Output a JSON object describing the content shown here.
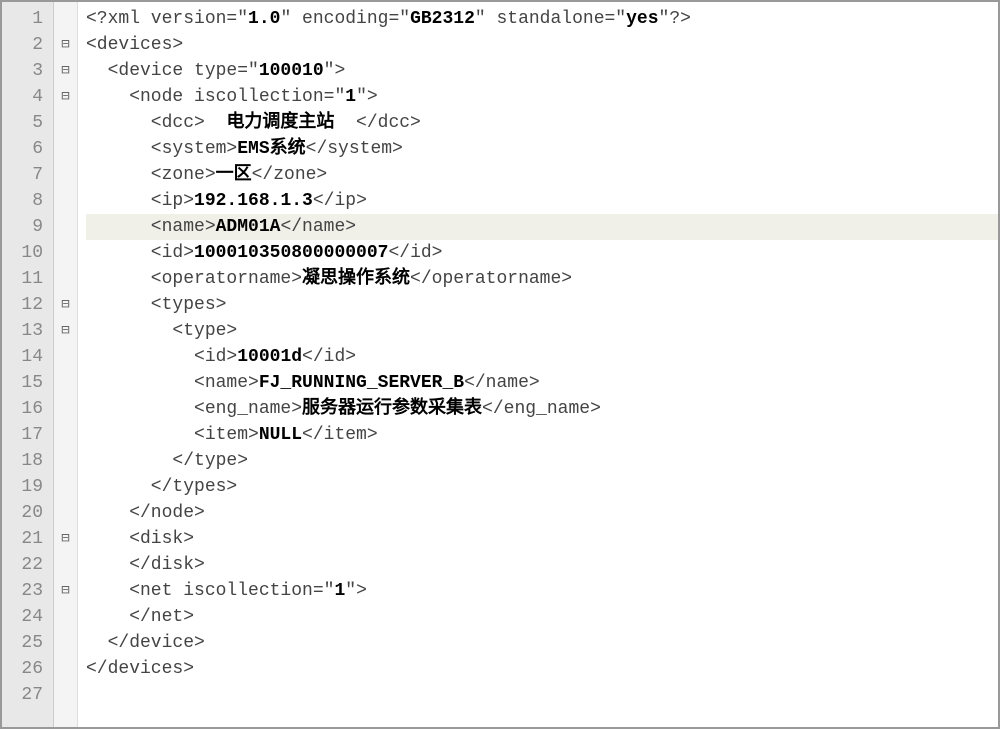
{
  "lines": {
    "1": {
      "ln": "1",
      "fold": "",
      "segs": [
        {
          "t": "<?xml version=\""
        },
        {
          "t": "1.0",
          "b": true
        },
        {
          "t": "\" encoding=\""
        },
        {
          "t": "GB2312",
          "b": true
        },
        {
          "t": "\" standalone=\""
        },
        {
          "t": "yes",
          "b": true
        },
        {
          "t": "\"?>"
        }
      ]
    },
    "2": {
      "ln": "2",
      "fold": "⊟",
      "segs": [
        {
          "t": "<devices>"
        }
      ]
    },
    "3": {
      "ln": "3",
      "fold": "⊟",
      "segs": [
        {
          "t": "  <device type=\""
        },
        {
          "t": "100010",
          "b": true
        },
        {
          "t": "\">"
        }
      ]
    },
    "4": {
      "ln": "4",
      "fold": "⊟",
      "segs": [
        {
          "t": "    <node iscollection=\""
        },
        {
          "t": "1",
          "b": true
        },
        {
          "t": "\">"
        }
      ]
    },
    "5": {
      "ln": "5",
      "fold": "",
      "segs": [
        {
          "t": "      <dcc>  "
        },
        {
          "t": "电力调度主站",
          "b": true
        },
        {
          "t": "  </dcc>"
        }
      ]
    },
    "6": {
      "ln": "6",
      "fold": "",
      "segs": [
        {
          "t": "      <system>"
        },
        {
          "t": "EMS系统",
          "b": true
        },
        {
          "t": "</system>"
        }
      ]
    },
    "7": {
      "ln": "7",
      "fold": "",
      "segs": [
        {
          "t": "      <zone>"
        },
        {
          "t": "一区",
          "b": true
        },
        {
          "t": "</zone>"
        }
      ]
    },
    "8": {
      "ln": "8",
      "fold": "",
      "segs": [
        {
          "t": "      <ip>"
        },
        {
          "t": "192.168.1.3",
          "b": true
        },
        {
          "t": "</ip>"
        }
      ]
    },
    "9": {
      "ln": "9",
      "fold": "",
      "hl": true,
      "segs": [
        {
          "t": "      <name>"
        },
        {
          "t": "ADM01A",
          "b": true
        },
        {
          "t": "</name>"
        }
      ]
    },
    "10": {
      "ln": "10",
      "fold": "",
      "segs": [
        {
          "t": "      <id>"
        },
        {
          "t": "100010350800000007",
          "b": true
        },
        {
          "t": "</id>"
        }
      ]
    },
    "11": {
      "ln": "11",
      "fold": "",
      "segs": [
        {
          "t": "      <operatorname>"
        },
        {
          "t": "凝思操作系统",
          "b": true
        },
        {
          "t": "</operatorname>"
        }
      ]
    },
    "12": {
      "ln": "12",
      "fold": "⊟",
      "segs": [
        {
          "t": "      <types>"
        }
      ]
    },
    "13": {
      "ln": "13",
      "fold": "⊟",
      "segs": [
        {
          "t": "        <type>"
        }
      ]
    },
    "14": {
      "ln": "14",
      "fold": "",
      "segs": [
        {
          "t": "          <id>"
        },
        {
          "t": "10001d",
          "b": true
        },
        {
          "t": "</id>"
        }
      ]
    },
    "15": {
      "ln": "15",
      "fold": "",
      "segs": [
        {
          "t": "          <name>"
        },
        {
          "t": "FJ_RUNNING_SERVER_B",
          "b": true
        },
        {
          "t": "</name>"
        }
      ]
    },
    "16": {
      "ln": "16",
      "fold": "",
      "segs": [
        {
          "t": "          <eng_name>"
        },
        {
          "t": "服务器运行参数采集表",
          "b": true
        },
        {
          "t": "</eng_name>"
        }
      ]
    },
    "17": {
      "ln": "17",
      "fold": "",
      "segs": [
        {
          "t": "          <item>"
        },
        {
          "t": "NULL",
          "b": true
        },
        {
          "t": "</item>"
        }
      ]
    },
    "18": {
      "ln": "18",
      "fold": "",
      "segs": [
        {
          "t": "        </type>"
        }
      ]
    },
    "19": {
      "ln": "19",
      "fold": "",
      "segs": [
        {
          "t": "      </types>"
        }
      ]
    },
    "20": {
      "ln": "20",
      "fold": "",
      "segs": [
        {
          "t": "    </node>"
        }
      ]
    },
    "21": {
      "ln": "21",
      "fold": "⊟",
      "segs": [
        {
          "t": "    <disk>"
        }
      ]
    },
    "22": {
      "ln": "22",
      "fold": "",
      "segs": [
        {
          "t": "    </disk>"
        }
      ]
    },
    "23": {
      "ln": "23",
      "fold": "⊟",
      "segs": [
        {
          "t": "    <net iscollection=\""
        },
        {
          "t": "1",
          "b": true
        },
        {
          "t": "\">"
        }
      ]
    },
    "24": {
      "ln": "24",
      "fold": "",
      "segs": [
        {
          "t": "    </net>"
        }
      ]
    },
    "25": {
      "ln": "25",
      "fold": "",
      "segs": [
        {
          "t": "  </device>"
        }
      ]
    },
    "26": {
      "ln": "26",
      "fold": "",
      "segs": [
        {
          "t": "</devices>"
        }
      ]
    },
    "27": {
      "ln": "27",
      "fold": "",
      "segs": []
    }
  },
  "lineCount": 27
}
